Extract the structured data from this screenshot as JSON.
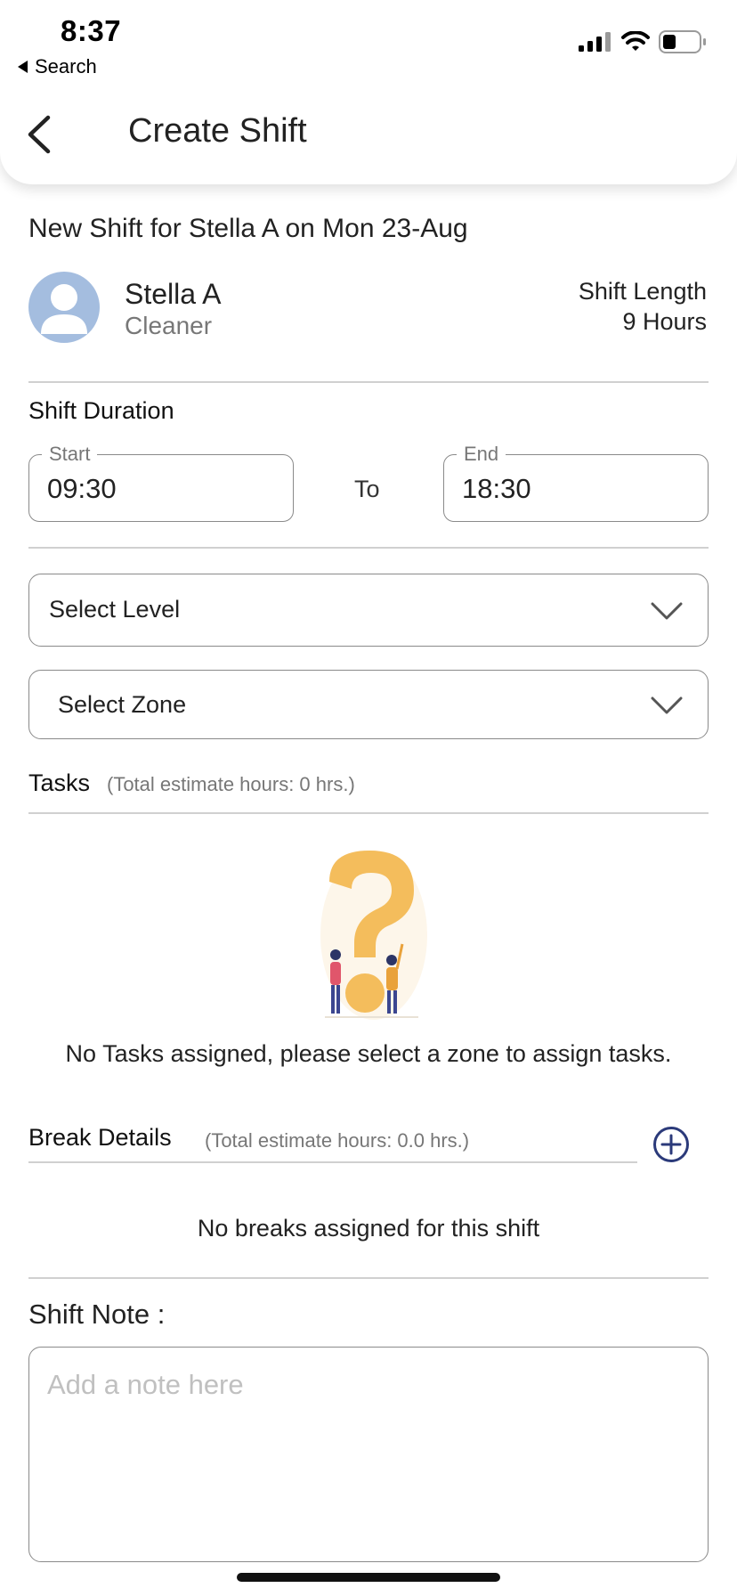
{
  "status_bar": {
    "time": "8:37",
    "back_app": "Search",
    "icons": [
      "signal-icon",
      "wifi-icon",
      "battery-icon"
    ]
  },
  "header": {
    "title": "Create Shift",
    "back_icon": "chevron-left-icon"
  },
  "summary": {
    "subtitle": "New Shift for Stella A on Mon 23-Aug",
    "employee_name": "Stella A",
    "employee_role": "Cleaner",
    "shift_length_label": "Shift Length",
    "shift_length_value": "9 Hours"
  },
  "duration": {
    "title": "Shift Duration",
    "start_label": "Start",
    "start_value": "09:30",
    "to_label": "To",
    "end_label": "End",
    "end_value": "18:30"
  },
  "selects": {
    "level": "Select Level",
    "zone": "Select Zone"
  },
  "tasks": {
    "title": "Tasks",
    "subtitle": "(Total estimate hours: 0 hrs.)",
    "empty_message": "No Tasks assigned, please select a zone to assign tasks."
  },
  "breaks": {
    "title": "Break Details",
    "subtitle": "(Total estimate hours: 0.0 hrs.)",
    "empty_message": "No breaks assigned for this shift",
    "add_icon": "plus-circle-icon"
  },
  "note": {
    "label": "Shift Note :",
    "placeholder": "Add a note here"
  },
  "colors": {
    "accent": "#2b3a7a",
    "avatar_bg": "#a4bddf",
    "illustration": "#f4bd5c"
  }
}
